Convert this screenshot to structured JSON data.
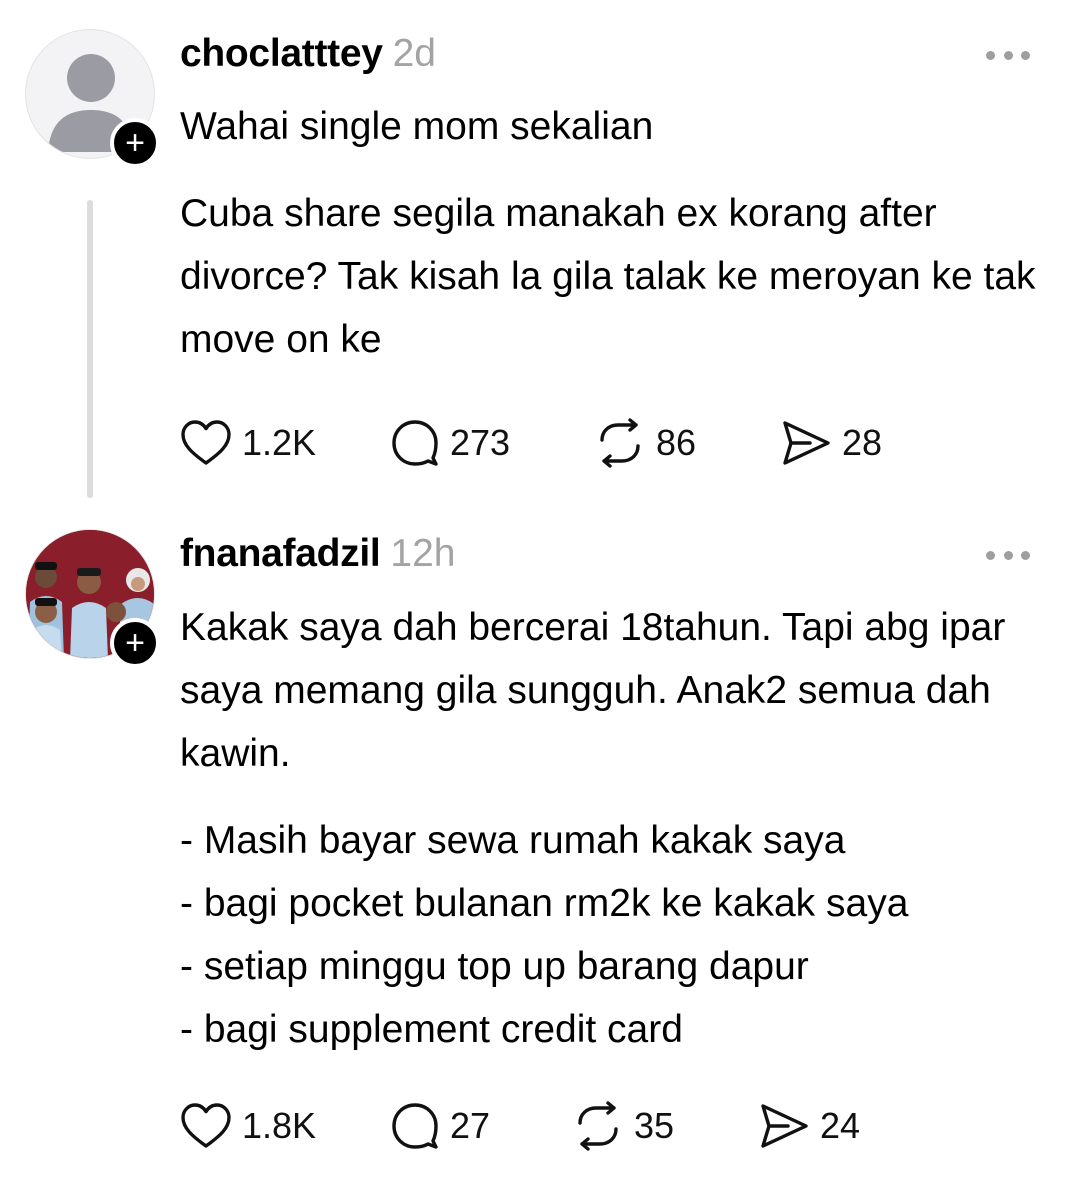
{
  "posts": [
    {
      "username": "choclatttey",
      "time": "2d",
      "avatar": "default-avatar",
      "paragraphs": [
        "Wahai single mom sekalian",
        "Cuba share segila manakah ex korang after divorce? Tak kisah la gila talak ke meroyan ke tak move on ke"
      ],
      "stats": {
        "likes": "1.2K",
        "replies": "273",
        "reposts": "86",
        "shares": "28"
      }
    },
    {
      "username": "fnanafadzil",
      "time": "12h",
      "avatar": "family-photo-avatar",
      "paragraphs": [
        "Kakak saya dah bercerai 18tahun. Tapi abg ipar saya memang gila sungguh. Anak2 semua dah kawin.",
        "- Masih bayar sewa rumah kakak saya",
        "- bagi pocket bulanan rm2k ke kakak saya",
        "- setiap minggu top up barang dapur",
        "- bagi supplement credit card"
      ],
      "stats": {
        "likes": "1.8K",
        "replies": "27",
        "reposts": "35",
        "shares": "24"
      }
    }
  ],
  "icons": {
    "like": "heart-icon",
    "reply": "comment-bubble-icon",
    "repost": "repost-arrows-icon",
    "share": "send-arrow-icon",
    "more": "ellipsis-icon",
    "follow": "plus-icon"
  },
  "colors": {
    "text": "#000000",
    "muted": "#a3a3a3",
    "thread_line": "#dcdcdc",
    "badge": "#000000"
  }
}
